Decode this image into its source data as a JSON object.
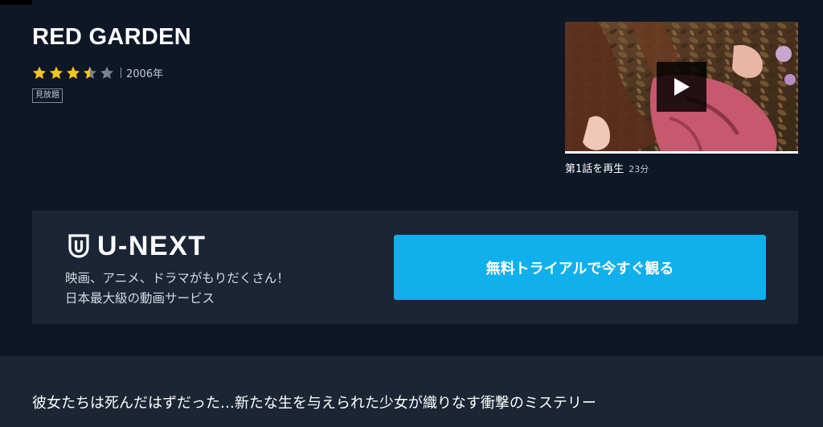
{
  "title": "RED GARDEN",
  "rating": {
    "value": 3.5,
    "max": 5,
    "star_color": "#f5c518",
    "empty_star_color": "#7a828e"
  },
  "year": "2006年",
  "badge": "見放題",
  "player": {
    "icon": "play-icon",
    "episode_label": "第1話を再生",
    "duration": "23分"
  },
  "promo": {
    "logo_text": "U-NEXT",
    "logo_icon": "u-next-shield-icon",
    "tagline_line1": "映画、アニメ、ドラマがもりだくさん！",
    "tagline_line2": "日本最大級の動画サービス",
    "cta_label": "無料トライアルで今すぐ観る",
    "cta_color": "#0fb0ec"
  },
  "description": "彼女たちは死んだはずだった…新たな生を与えられた少女が織りなす衝撃のミステリー"
}
